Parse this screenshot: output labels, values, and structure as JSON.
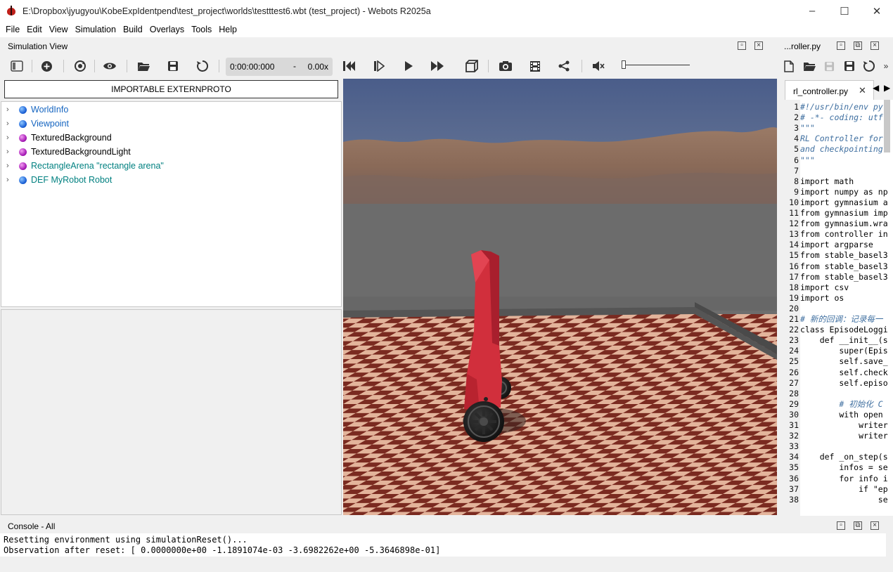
{
  "window": {
    "title": "E:\\Dropbox\\jyugyou\\KobeExpIdentpend\\test_project\\worlds\\testttest6.wbt (test_project) - Webots R2025a",
    "controls": [
      "–",
      "☐",
      "✕"
    ]
  },
  "menu": [
    "File",
    "Edit",
    "View",
    "Simulation",
    "Build",
    "Overlays",
    "Tools",
    "Help"
  ],
  "sim_view": {
    "label": "Simulation View"
  },
  "toolbar": {
    "time": "0:00:00:000",
    "dash": "-",
    "speed": "0.00x"
  },
  "scene_tree": {
    "proto_button": "IMPORTABLE EXTERNPROTO",
    "items": [
      {
        "label": "WorldInfo",
        "color": "#1a5fd6",
        "text_color": "#1565c0"
      },
      {
        "label": "Viewpoint",
        "color": "#1a5fd6",
        "text_color": "#1565c0"
      },
      {
        "label": "TexturedBackground",
        "color": "#a519b5",
        "text_color": "#000000"
      },
      {
        "label": "TexturedBackgroundLight",
        "color": "#a519b5",
        "text_color": "#000000"
      },
      {
        "label": "RectangleArena \"rectangle arena\"",
        "color": "#a519b5",
        "text_color": "#008080"
      },
      {
        "label": "DEF MyRobot Robot",
        "color": "#1a5fd6",
        "text_color": "#008080"
      }
    ]
  },
  "editor": {
    "header_label": "...roller.py",
    "tab_label": "rl_controller.py",
    "tab_close": "✕",
    "lines": [
      {
        "n": "1",
        "code": "#!/usr/bin/env pyt",
        "kind": "com"
      },
      {
        "n": "2",
        "code": "# -*- coding: utf-",
        "kind": "com"
      },
      {
        "n": "3",
        "code": "\"\"\"",
        "kind": "com"
      },
      {
        "n": "4",
        "code": "RL Controller for",
        "kind": "com"
      },
      {
        "n": "5",
        "code": "and checkpointing",
        "kind": "com"
      },
      {
        "n": "6",
        "code": "\"\"\"",
        "kind": "com"
      },
      {
        "n": "7",
        "code": "",
        "kind": "code"
      },
      {
        "n": "8",
        "code": "import math",
        "kind": "code"
      },
      {
        "n": "9",
        "code": "import numpy as np",
        "kind": "code"
      },
      {
        "n": "10",
        "code": "import gymnasium a",
        "kind": "code"
      },
      {
        "n": "11",
        "code": "from gymnasium imp",
        "kind": "code"
      },
      {
        "n": "12",
        "code": "from gymnasium.wra",
        "kind": "code"
      },
      {
        "n": "13",
        "code": "from controller in",
        "kind": "code"
      },
      {
        "n": "14",
        "code": "import argparse",
        "kind": "code"
      },
      {
        "n": "15",
        "code": "from stable_basel3",
        "kind": "code"
      },
      {
        "n": "16",
        "code": "from stable_basel3",
        "kind": "code"
      },
      {
        "n": "17",
        "code": "from stable_basel3",
        "kind": "code"
      },
      {
        "n": "18",
        "code": "import csv",
        "kind": "code"
      },
      {
        "n": "19",
        "code": "import os",
        "kind": "code"
      },
      {
        "n": "20",
        "code": "",
        "kind": "code"
      },
      {
        "n": "21",
        "code": "# 新的回调：记录每一",
        "kind": "com"
      },
      {
        "n": "22",
        "code": "class EpisodeLoggi",
        "kind": "code"
      },
      {
        "n": "23",
        "code": "    def __init__(s",
        "kind": "code"
      },
      {
        "n": "24",
        "code": "        super(Epis",
        "kind": "code"
      },
      {
        "n": "25",
        "code": "        self.save_",
        "kind": "code"
      },
      {
        "n": "26",
        "code": "        self.check",
        "kind": "code"
      },
      {
        "n": "27",
        "code": "        self.episo",
        "kind": "code"
      },
      {
        "n": "28",
        "code": "",
        "kind": "code"
      },
      {
        "n": "29",
        "code": "        # 初始化 C",
        "kind": "com"
      },
      {
        "n": "30",
        "code": "        with open",
        "kind": "code"
      },
      {
        "n": "31",
        "code": "            writer",
        "kind": "code"
      },
      {
        "n": "32",
        "code": "            writer",
        "kind": "code"
      },
      {
        "n": "33",
        "code": "",
        "kind": "code"
      },
      {
        "n": "34",
        "code": "    def _on_step(s",
        "kind": "code"
      },
      {
        "n": "35",
        "code": "        infos = se",
        "kind": "code"
      },
      {
        "n": "36",
        "code": "        for info i",
        "kind": "code"
      },
      {
        "n": "37",
        "code": "            if \"ep",
        "kind": "code"
      },
      {
        "n": "38",
        "code": "                se",
        "kind": "code"
      }
    ]
  },
  "console": {
    "label": "Console - All",
    "lines": [
      "Resetting environment using simulationReset()...",
      "Observation after reset: [ 0.0000000e+00 -1.1891074e-03 -3.6982262e+00 -5.3646898e-01]"
    ]
  },
  "icons": {
    "toolbar": [
      "toggle-panel-icon",
      "add-node-icon",
      "reload-world-icon",
      "view-icon",
      "open-world-icon",
      "save-world-icon",
      "reset-icon",
      "step-back-icon",
      "step-icon",
      "play-icon",
      "fast-forward-icon",
      "box-view-icon",
      "camera-icon",
      "film-icon",
      "share-icon",
      "mute-icon"
    ],
    "editor": [
      "new-file-icon",
      "open-file-icon",
      "save-file-icon",
      "save-as-icon",
      "revert-icon"
    ]
  }
}
